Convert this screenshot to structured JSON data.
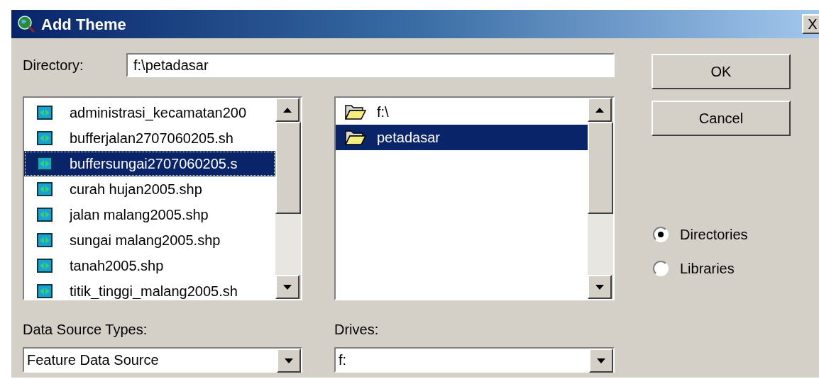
{
  "window": {
    "title": "Add Theme",
    "close": "X"
  },
  "directory": {
    "label": "Directory:",
    "value": "f:\\petadasar"
  },
  "files": [
    {
      "name": "administrasi_kecamatan200",
      "selected": false
    },
    {
      "name": "bufferjalan2707060205.sh",
      "selected": false
    },
    {
      "name": "buffersungai2707060205.s",
      "selected": true
    },
    {
      "name": "curah hujan2005.shp",
      "selected": false
    },
    {
      "name": "jalan malang2005.shp",
      "selected": false
    },
    {
      "name": "sungai malang2005.shp",
      "selected": false
    },
    {
      "name": "tanah2005.shp",
      "selected": false
    },
    {
      "name": "titik_tinggi_malang2005.sh",
      "selected": false
    }
  ],
  "folders": [
    {
      "name": "f:\\",
      "selected": false
    },
    {
      "name": "petadasar",
      "selected": true
    }
  ],
  "buttons": [
    "OK",
    "Cancel"
  ],
  "options": [
    {
      "label": "Directories",
      "selected": true
    },
    {
      "label": "Libraries",
      "selected": false
    }
  ],
  "data_source_types": {
    "label": "Data Source Types:",
    "value": "Feature Data Source"
  },
  "drives": {
    "label": "Drives:",
    "value": "f:"
  }
}
